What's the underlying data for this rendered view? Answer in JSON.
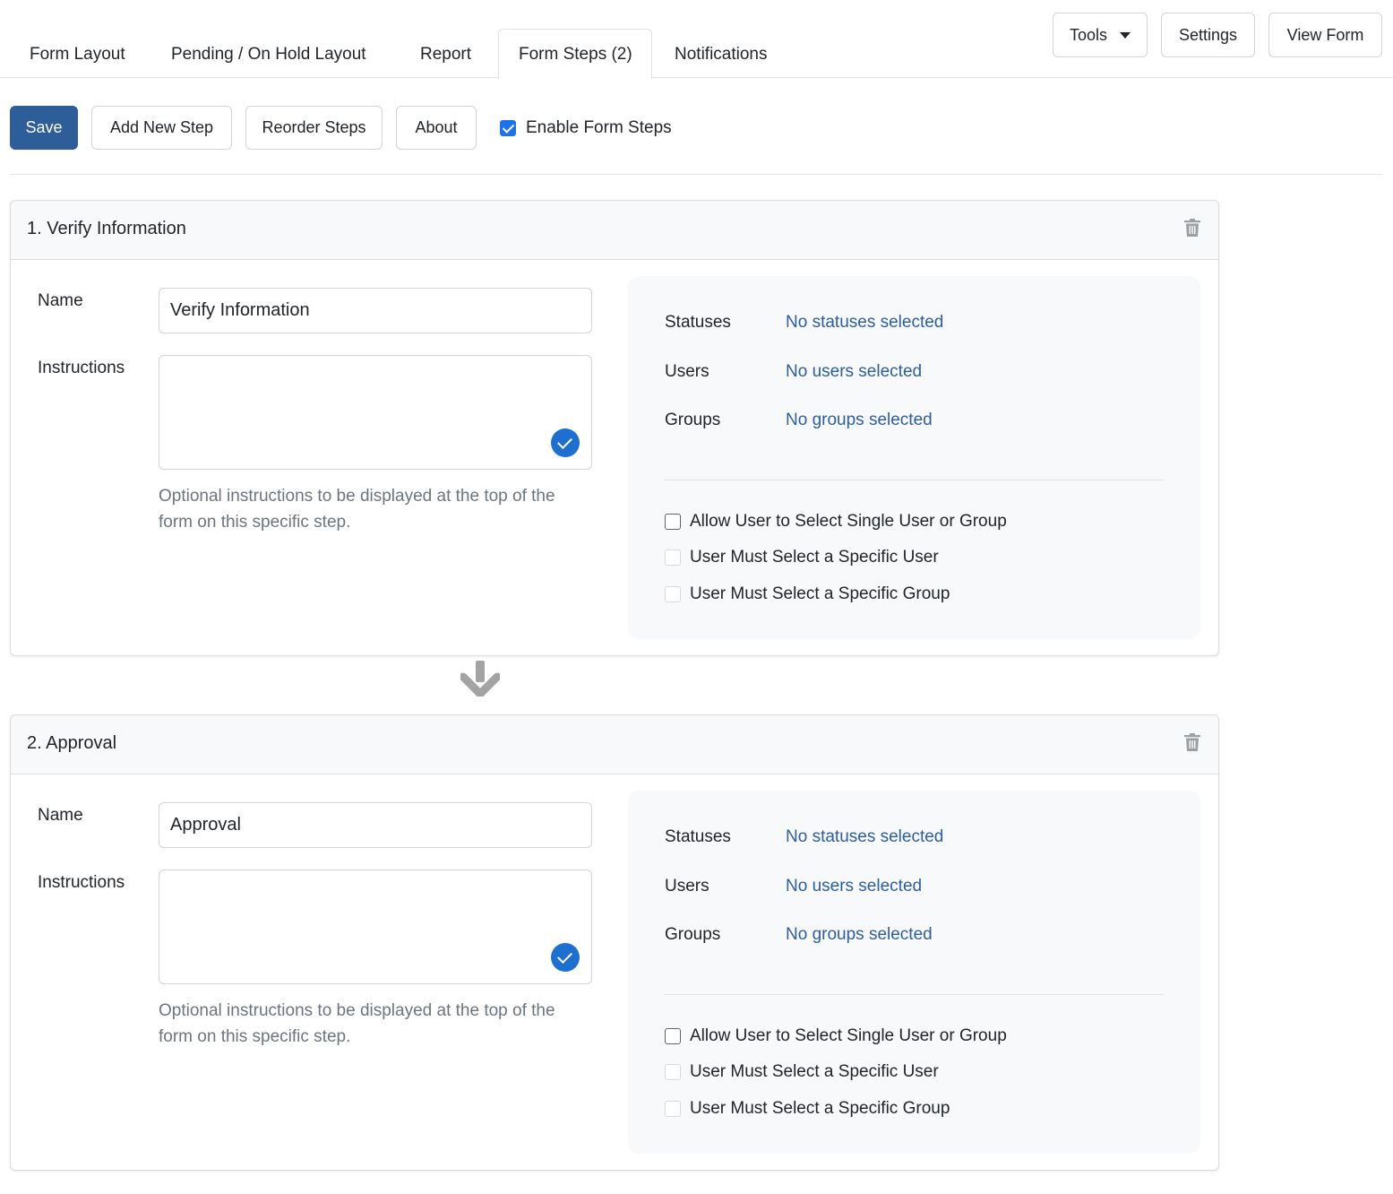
{
  "tabs": [
    {
      "label": "Form Layout",
      "active": false
    },
    {
      "label": "Pending / On Hold Layout",
      "active": false
    },
    {
      "label": "Report",
      "active": false
    },
    {
      "label": "Form Steps (2)",
      "active": true
    },
    {
      "label": "Notifications",
      "active": false
    }
  ],
  "header_buttons": {
    "tools": "Tools",
    "settings": "Settings",
    "view_form": "View Form"
  },
  "toolbar": {
    "save": "Save",
    "add_new_step": "Add New Step",
    "reorder_steps": "Reorder Steps",
    "about": "About",
    "enable_form_steps": {
      "label": "Enable Form Steps",
      "checked": true
    }
  },
  "labels": {
    "name": "Name",
    "instructions": "Instructions",
    "instructions_help": "Optional instructions to be displayed at the top of the form on this specific step.",
    "statuses": "Statuses",
    "users": "Users",
    "groups": "Groups"
  },
  "steps": [
    {
      "title": "1. Verify Information",
      "name": "Verify Information",
      "instructions": "",
      "statuses": "No statuses selected",
      "users": "No users selected",
      "groups": "No groups selected",
      "options": [
        {
          "label": "Allow User to Select Single User or Group",
          "checked": false,
          "disabled": false
        },
        {
          "label": "User Must Select a Specific User",
          "checked": false,
          "disabled": true
        },
        {
          "label": "User Must Select a Specific Group",
          "checked": false,
          "disabled": true
        }
      ]
    },
    {
      "title": "2. Approval",
      "name": "Approval",
      "instructions": "",
      "statuses": "No statuses selected",
      "users": "No users selected",
      "groups": "No groups selected",
      "options": [
        {
          "label": "Allow User to Select Single User or Group",
          "checked": false,
          "disabled": false
        },
        {
          "label": "User Must Select a Specific User",
          "checked": false,
          "disabled": true
        },
        {
          "label": "User Must Select a Specific Group",
          "checked": false,
          "disabled": true
        }
      ]
    }
  ],
  "icons": {
    "delete": "trash-icon",
    "step_connector": "arrow-down-icon",
    "grammar": "grammarly-check-icon"
  },
  "colors": {
    "primary": "#2e5e9a",
    "link": "#2e5e9a",
    "help_text": "#6c757d",
    "checkbox_checked": "#1a73e8"
  }
}
